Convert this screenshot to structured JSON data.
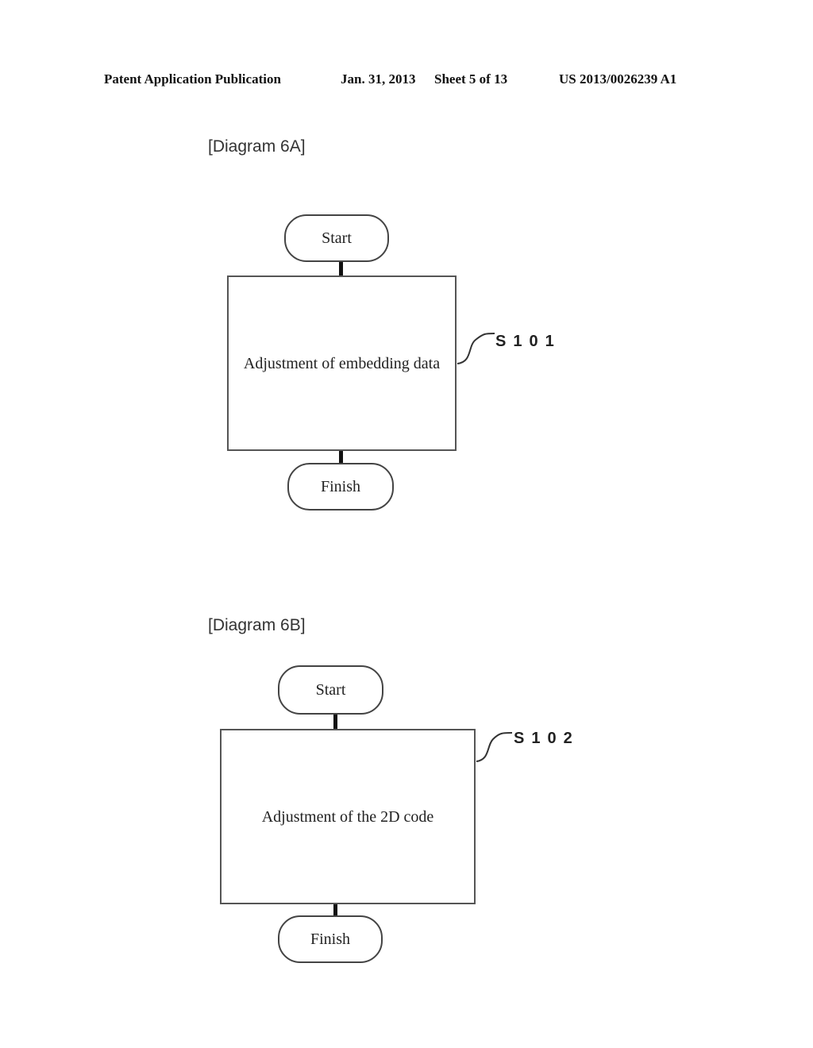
{
  "header": {
    "publication": "Patent Application Publication",
    "date": "Jan. 31, 2013",
    "sheet": "Sheet 5 of 13",
    "number": "US 2013/0026239 A1"
  },
  "diagrams": [
    {
      "label": "[Diagram 6A]",
      "start": "Start",
      "process": "Adjustment of embedding data",
      "finish": "Finish",
      "step_ref": "S101"
    },
    {
      "label": "[Diagram 6B]",
      "start": "Start",
      "process": "Adjustment of the 2D code",
      "finish": "Finish",
      "step_ref": "S102"
    }
  ]
}
